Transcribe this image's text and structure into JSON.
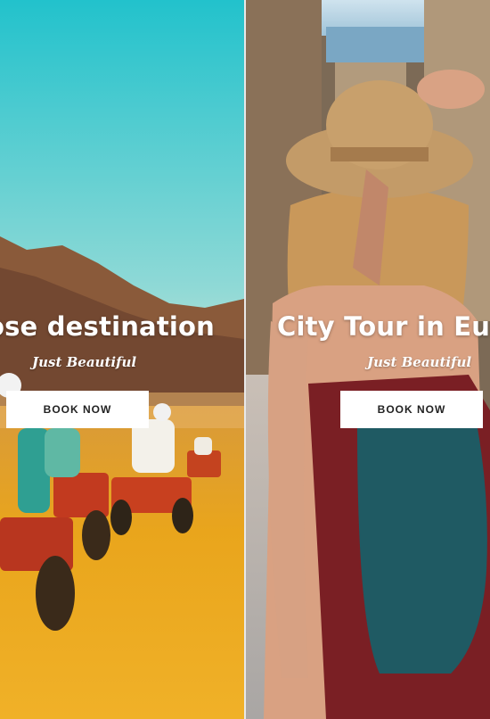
{
  "slides": [
    {
      "title": "ose destination",
      "subtitle": "Just Beautiful",
      "button_label": "BOOK NOW",
      "image": "desert-quad-bike-tour-photo"
    },
    {
      "title": "City Tour in Eur",
      "subtitle": "Just Beautiful",
      "button_label": "BOOK NOW",
      "image": "woman-in-straw-hat-city-street-photo"
    }
  ],
  "colors": {
    "sky_top": "#27c3cc",
    "desert_sand": "#e8a21a",
    "dress_red": "#7a1f24",
    "bag_teal": "#1f5a63",
    "button_bg": "#ffffff",
    "text": "#ffffff"
  }
}
